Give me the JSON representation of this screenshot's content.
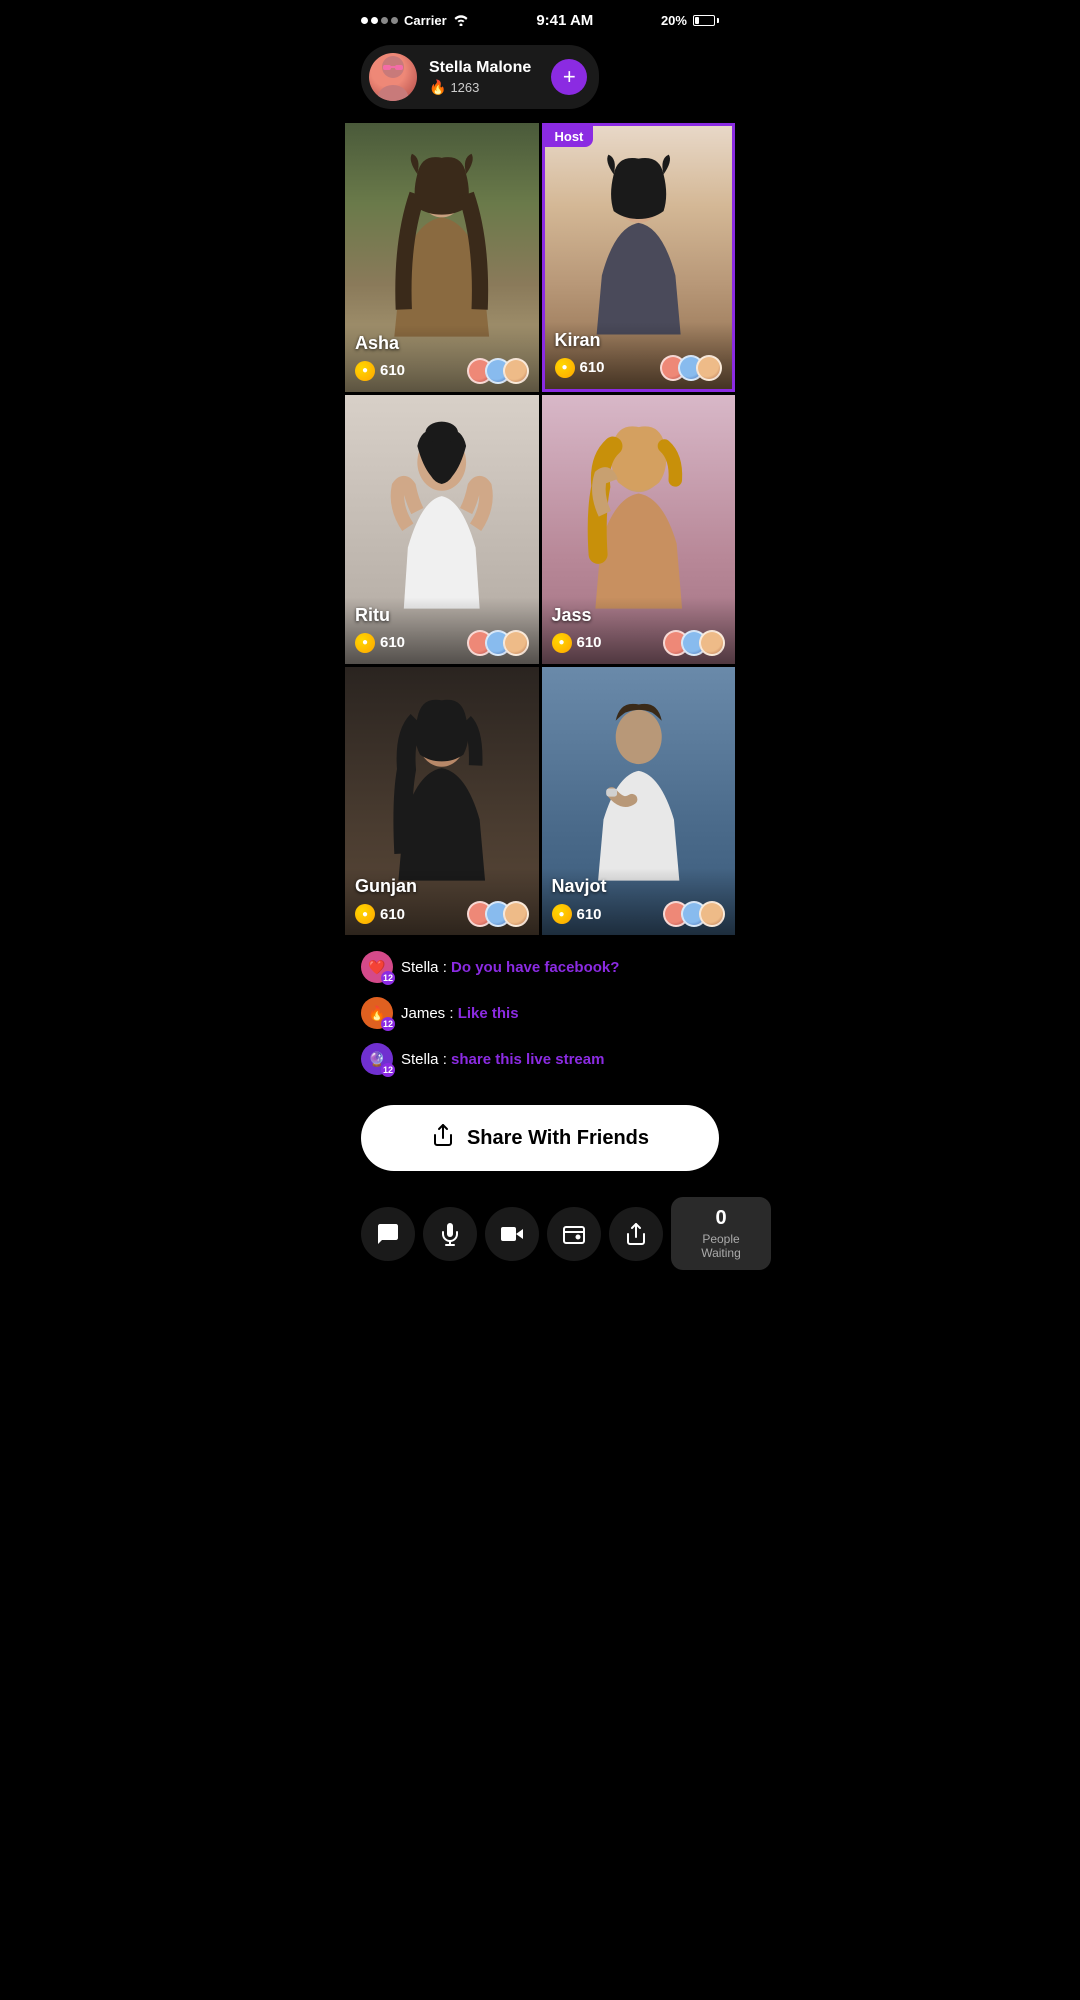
{
  "statusBar": {
    "carrier": "Carrier",
    "time": "9:41 AM",
    "battery": "20%"
  },
  "hostCard": {
    "name": "Stella Malone",
    "score": "1263",
    "addLabel": "+"
  },
  "grid": {
    "cells": [
      {
        "id": "asha",
        "name": "Asha",
        "score": "610",
        "isHost": false,
        "colorClass": "cell-asha"
      },
      {
        "id": "kiran",
        "name": "Kiran",
        "score": "610",
        "isHost": true,
        "colorClass": "cell-kiran"
      },
      {
        "id": "ritu",
        "name": "Ritu",
        "score": "610",
        "isHost": false,
        "colorClass": "cell-ritu"
      },
      {
        "id": "jass",
        "name": "Jass",
        "score": "610",
        "isHost": false,
        "colorClass": "cell-jass"
      },
      {
        "id": "gunjan",
        "name": "Gunjan",
        "score": "610",
        "isHost": false,
        "colorClass": "cell-gunjan"
      },
      {
        "id": "navjot",
        "name": "Navjot",
        "score": "610",
        "isHost": false,
        "colorClass": "cell-navjot"
      }
    ],
    "hostBadge": "Host"
  },
  "chat": {
    "messages": [
      {
        "user": "Stella",
        "text": "Do you have facebook?",
        "badgeClass": "badge-pink",
        "badgeNum": "12",
        "emoji": "❤️"
      },
      {
        "user": "James",
        "text": "Like this",
        "badgeClass": "badge-orange",
        "badgeNum": "12",
        "emoji": "🔥"
      },
      {
        "user": "Stella",
        "text": "share this live stream",
        "badgeClass": "badge-purple",
        "badgeNum": "12",
        "emoji": "🔮"
      }
    ]
  },
  "shareButton": {
    "label": "Share With Friends"
  },
  "bottomBar": {
    "peopleWaiting": {
      "count": "0",
      "label": "People Waiting"
    }
  }
}
